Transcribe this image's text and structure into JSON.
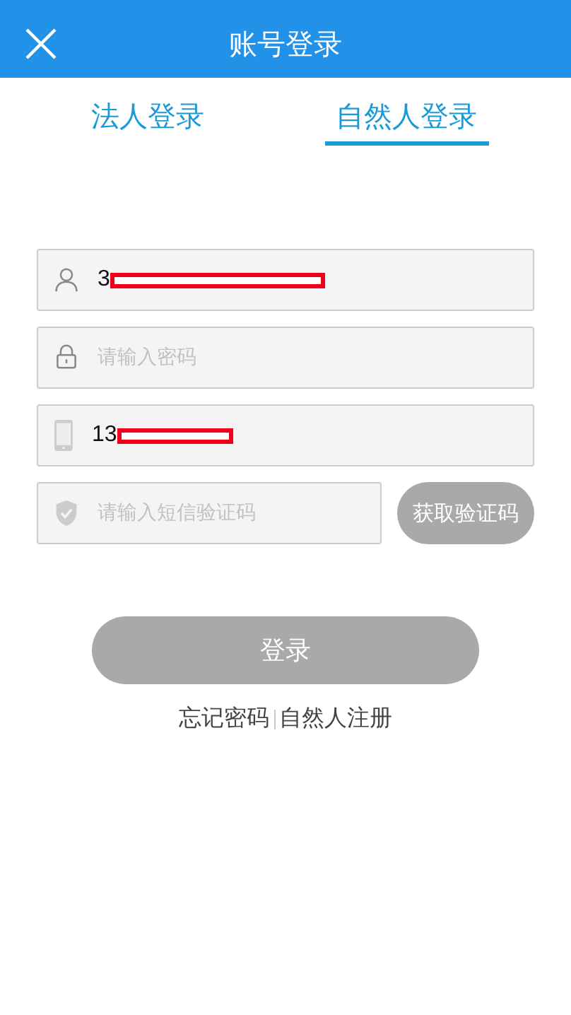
{
  "header": {
    "title": "账号登录"
  },
  "tabs": [
    {
      "label": "法人登录",
      "selected": false
    },
    {
      "label": "自然人登录",
      "selected": true
    }
  ],
  "fields": [
    {
      "kind": "user",
      "value": "3",
      "redacted": true
    },
    {
      "kind": "lock",
      "placeholder": "请输入密码"
    },
    {
      "kind": "phone",
      "value": "13",
      "redacted": true
    }
  ],
  "sms": {
    "placeholder": "请输入短信验证码",
    "button": "获取验证码",
    "disabled": true
  },
  "login": {
    "label": "登录",
    "disabled": true
  },
  "links": [
    "忘记密码",
    "自然人注册"
  ]
}
